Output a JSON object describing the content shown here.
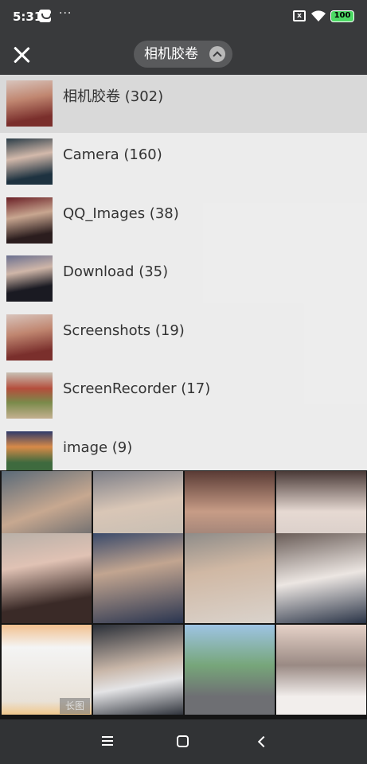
{
  "status_bar": {
    "time": "5:31",
    "dots": "···",
    "sim_label": "x",
    "battery": "100"
  },
  "title_bar": {
    "album_selector_label": "相机胶卷"
  },
  "albums": [
    {
      "name": "相机胶卷 (302)",
      "selected": true
    },
    {
      "name": "Camera (160)"
    },
    {
      "name": "QQ_Images (38)"
    },
    {
      "name": "Download (35)"
    },
    {
      "name": "Screenshots (19)"
    },
    {
      "name": "ScreenRecorder (17)"
    },
    {
      "name": "image (9)"
    }
  ],
  "grid": {
    "long_image_badge": "长图"
  },
  "colors": {
    "toolbar": "#393a3c",
    "nav": "#313335",
    "battery": "#4cd964"
  }
}
